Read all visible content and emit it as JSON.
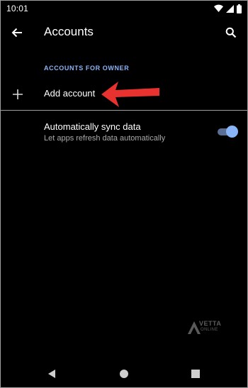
{
  "status_bar": {
    "time": "10:01",
    "icons": [
      "wifi-icon",
      "signal-icon",
      "battery-icon"
    ]
  },
  "app_bar": {
    "title": "Accounts",
    "back_icon": "arrow-back-icon",
    "search_icon": "search-icon"
  },
  "section": {
    "header": "ACCOUNTS FOR OWNER"
  },
  "add_account": {
    "label": "Add account",
    "icon": "plus-icon"
  },
  "sync": {
    "title": "Automatically sync data",
    "summary": "Let apps refresh data automatically",
    "enabled": true
  },
  "watermark": {
    "line1": "VETTA",
    "line2": "ONLINE"
  },
  "nav_bar": {
    "icons": [
      "back-triangle-icon",
      "home-circle-icon",
      "recents-square-icon"
    ]
  },
  "colors": {
    "background": "#000000",
    "accent": "#8ab4f8",
    "annotation": "#e8322f",
    "divider": "#9e9e9e"
  }
}
